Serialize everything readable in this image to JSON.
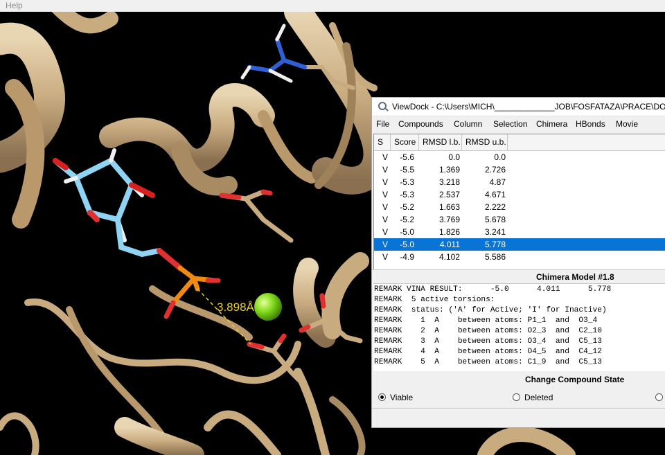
{
  "top_menu": {
    "help": "Help"
  },
  "viewer": {
    "distance_label": "3.898Å"
  },
  "viewdock": {
    "title": "ViewDock - C:\\Users\\MICH\\_____________JOB\\FOSFATAZA\\PRACE\\DOCKI",
    "menu": [
      "File",
      "Compounds",
      "Column",
      "Selection",
      "Chimera",
      "HBonds",
      "Movie"
    ],
    "columns": [
      "S",
      "Score",
      "RMSD l.b.",
      "RMSD u.b."
    ],
    "rows": [
      {
        "s": "V",
        "score": "-5.6",
        "lb": "0.0",
        "ub": "0.0"
      },
      {
        "s": "V",
        "score": "-5.5",
        "lb": "1.369",
        "ub": "2.726"
      },
      {
        "s": "V",
        "score": "-5.3",
        "lb": "3.218",
        "ub": "4.87"
      },
      {
        "s": "V",
        "score": "-5.3",
        "lb": "2.537",
        "ub": "4.671"
      },
      {
        "s": "V",
        "score": "-5.2",
        "lb": "1.663",
        "ub": "2.222"
      },
      {
        "s": "V",
        "score": "-5.2",
        "lb": "3.769",
        "ub": "5.678"
      },
      {
        "s": "V",
        "score": "-5.0",
        "lb": "1.826",
        "ub": "3.241"
      },
      {
        "s": "V",
        "score": "-5.0",
        "lb": "4.011",
        "ub": "5.778"
      },
      {
        "s": "V",
        "score": "-4.9",
        "lb": "4.102",
        "ub": "5.586"
      }
    ],
    "selected_row": 7,
    "model_title": "Chimera Model #1.8",
    "remarks": [
      "REMARK VINA RESULT:      -5.0      4.011      5.778",
      "REMARK  5 active torsions:",
      "REMARK  status: ('A' for Active; 'I' for Inactive)",
      "REMARK    1  A    between atoms: P1_1  and  O3_4",
      "REMARK    2  A    between atoms: O2_3  and  C2_10",
      "REMARK    3  A    between atoms: O3_4  and  C5_13",
      "REMARK    4  A    between atoms: O4_5  and  C4_12",
      "REMARK    5  A    between atoms: C1_9  and  C5_13"
    ],
    "state_title": "Change Compound State",
    "states": [
      {
        "label": "Viable",
        "checked": true
      },
      {
        "label": "Deleted",
        "checked": false
      },
      {
        "label": "",
        "checked": false
      }
    ]
  }
}
